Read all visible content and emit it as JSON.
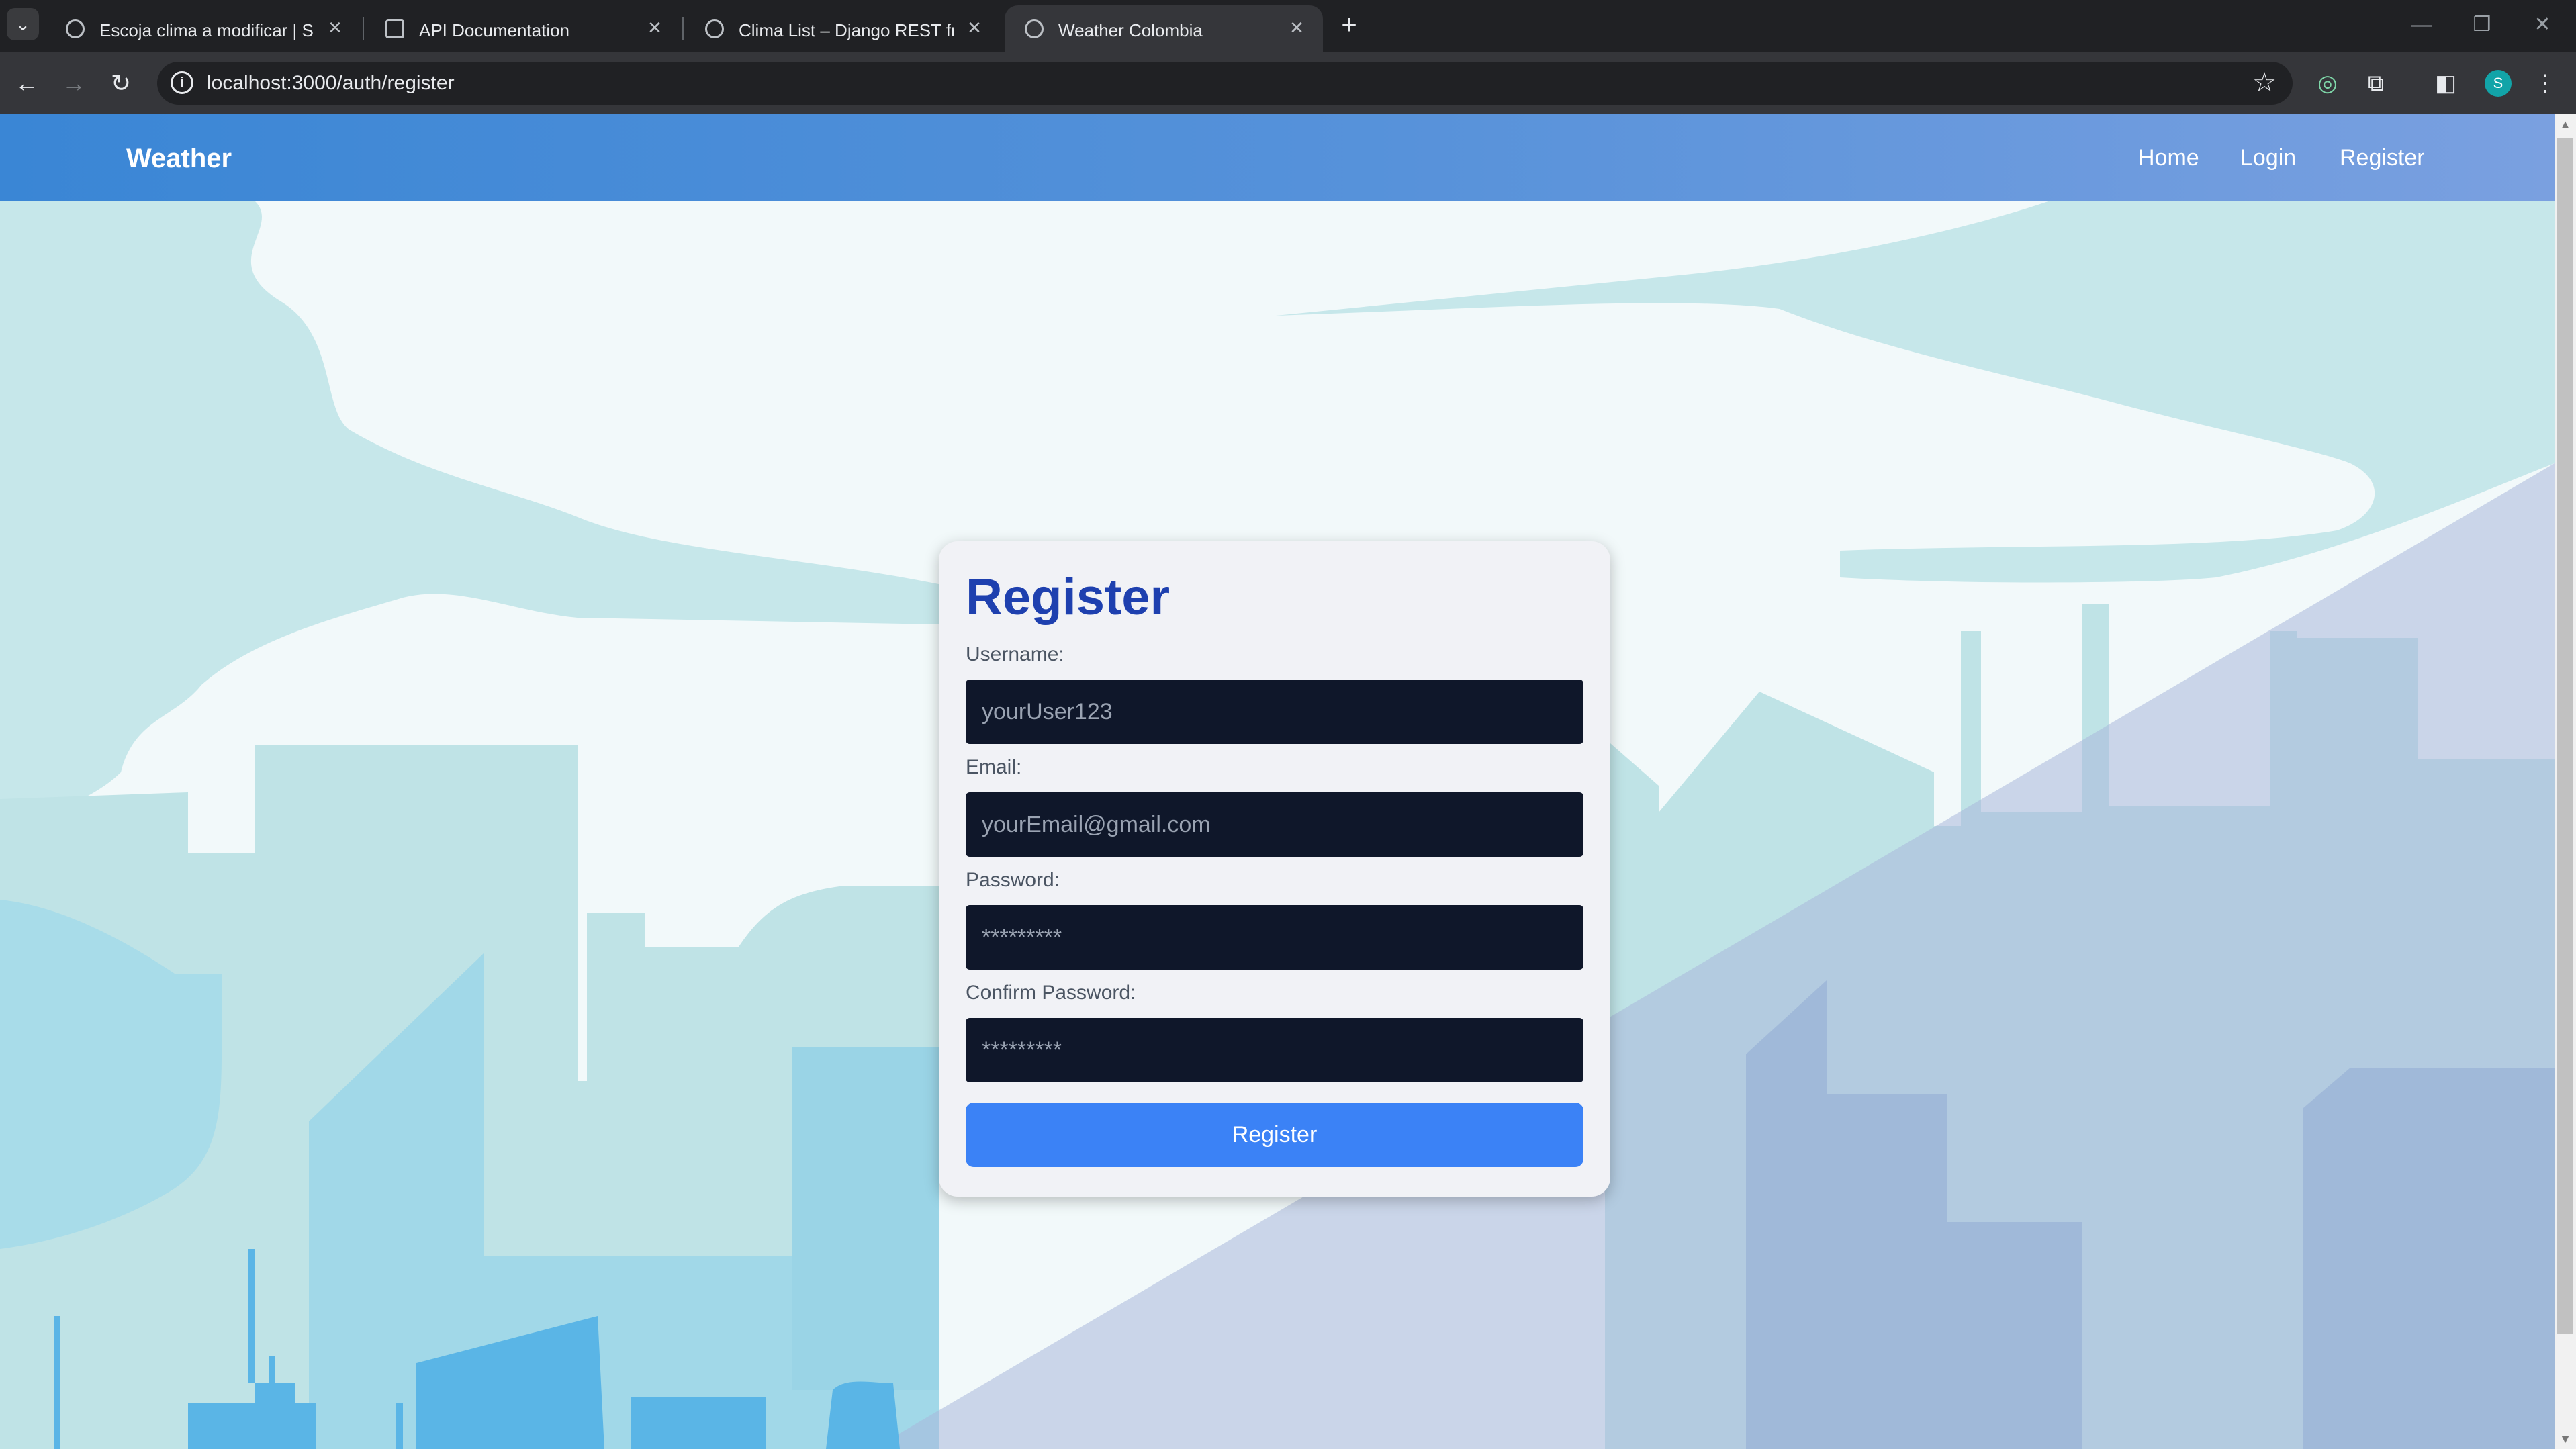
{
  "browser": {
    "tabs": [
      {
        "title": "Escoja clima a modificar | Sitio de administración de Django",
        "active": false,
        "icon": "globe-icon"
      },
      {
        "title": "API Documentation",
        "active": false,
        "icon": "document-icon"
      },
      {
        "title": "Clima List – Django REST framework",
        "active": false,
        "icon": "globe-icon"
      },
      {
        "title": "Weather Colombia",
        "active": true,
        "icon": "globe-icon"
      }
    ],
    "new_tab": "+",
    "url": "localhost:3000/auth/register",
    "profile_initial": "S"
  },
  "navbar": {
    "brand": "Weather",
    "links": [
      "Home",
      "Login",
      "Register"
    ]
  },
  "form": {
    "heading": "Register",
    "username_label": "Username:",
    "username_placeholder": "yourUser123",
    "email_label": "Email:",
    "email_placeholder": "yourEmail@gmail.com",
    "password_label": "Password:",
    "password_placeholder": "*********",
    "confirm_label": "Confirm Password:",
    "confirm_placeholder": "*********",
    "submit_label": "Register"
  },
  "colors": {
    "navbar_start": "#3a86d5",
    "navbar_end": "#7aa0e0",
    "heading": "#1e40af",
    "input_bg": "#0f172a",
    "button": "#3b82f6"
  }
}
